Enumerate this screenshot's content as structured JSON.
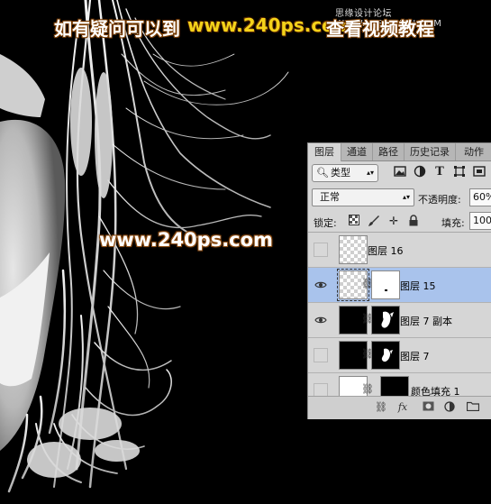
{
  "watermark": {
    "question": "如有疑问可以到",
    "url": "www.240ps.com",
    "tutorial": "查看视频教程",
    "small_site": "思缘设计论坛  WWW.MISSYUAN.COM",
    "center_url": "www.240ps.com"
  },
  "panel": {
    "tabs": [
      "图层",
      "通道",
      "路径",
      "历史记录",
      "动作"
    ],
    "active_tab": "图层",
    "filter": {
      "kind_label": "类型",
      "search_icon": "search-icon",
      "arrow_icon": "updown-arrow-icon",
      "filter_icons": [
        "image-filter-icon",
        "adjustment-filter-icon",
        "type-filter-icon",
        "shape-filter-icon",
        "smart-object-filter-icon"
      ]
    },
    "blend_mode": "正常",
    "opacity_label": "不透明度:",
    "opacity_value": "60%",
    "lock_label": "锁定:",
    "lock_icons": [
      "lock-transparent-icon",
      "lock-paint-icon",
      "lock-move-icon",
      "lock-all-icon"
    ],
    "fill_label": "填充:",
    "fill_value": "100%",
    "layers": [
      {
        "name": "图层 16",
        "visible": false,
        "selected": false
      },
      {
        "name": "图层 15",
        "visible": true,
        "selected": true
      },
      {
        "name": "图层 7 副本",
        "visible": true,
        "selected": false
      },
      {
        "name": "图层 7",
        "visible": false,
        "selected": false
      },
      {
        "name": "颜色填充 1",
        "visible": false,
        "selected": false
      }
    ],
    "bottom": {
      "fx": "fx"
    }
  },
  "colors": {
    "selection": "#a9c3ec",
    "watermark_url": "#f4d21a",
    "panel_bg": "#d6d6d6"
  }
}
